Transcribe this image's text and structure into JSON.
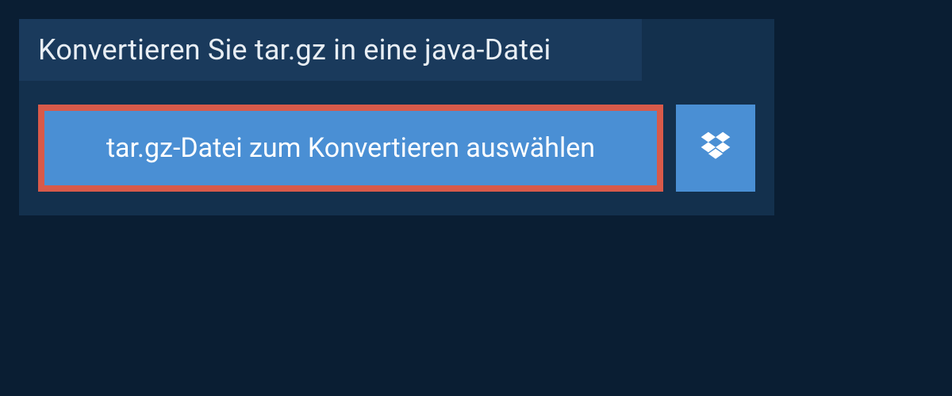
{
  "header": {
    "title": "Konvertieren Sie tar.gz in eine java-Datei"
  },
  "upload": {
    "select_label": "tar.gz-Datei zum Konvertieren auswählen",
    "dropbox_icon": "dropbox"
  },
  "colors": {
    "background": "#0a1e33",
    "panel": "#13304d",
    "header_bar": "#1a3a5c",
    "button": "#4a8fd4",
    "highlight_border": "#d85a4a",
    "text_light": "#e8eef4",
    "text_white": "#ffffff"
  }
}
